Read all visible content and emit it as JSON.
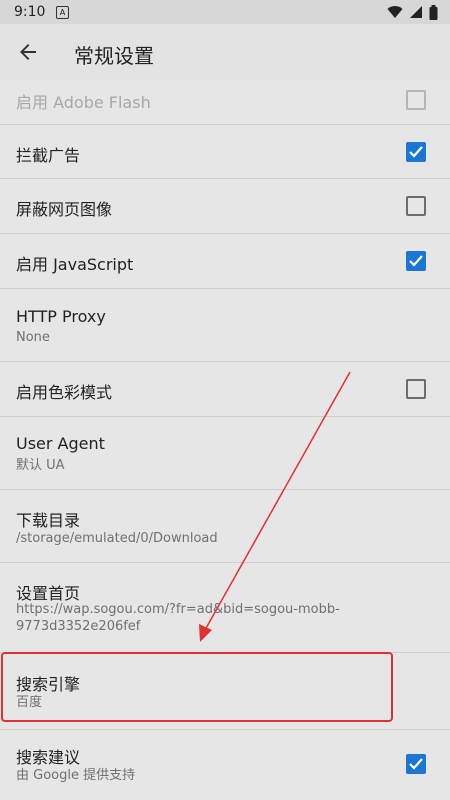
{
  "status_bar": {
    "time": "9:10",
    "notification_icon": "A"
  },
  "app_bar": {
    "back_icon": "arrow-left-icon",
    "title": "常规设置"
  },
  "settings": [
    {
      "title": "启用 Adobe Flash",
      "checkbox": true,
      "checked": false,
      "disabled": true
    },
    {
      "title": "拦截广告",
      "checkbox": true,
      "checked": true
    },
    {
      "title": "屏蔽网页图像",
      "checkbox": true,
      "checked": false
    },
    {
      "title": "启用 JavaScript",
      "checkbox": true,
      "checked": true
    },
    {
      "title": "HTTP Proxy",
      "subtitle": "None"
    },
    {
      "title": "启用色彩模式",
      "checkbox": true,
      "checked": false
    },
    {
      "title": "User Agent",
      "subtitle": "默认 UA"
    },
    {
      "title": "下载目录",
      "subtitle": "/storage/emulated/0/Download"
    },
    {
      "title": "设置首页",
      "subtitle": "https://wap.sogou.com/?fr=ad&bid=sogou-mobb-9773d3352e206fef"
    },
    {
      "title": "搜索引擎",
      "subtitle": "百度",
      "highlighted": true
    },
    {
      "title": "搜索建议",
      "subtitle": "由 Google 提供支持",
      "checkbox": true,
      "checked": true
    }
  ],
  "colors": {
    "accent": "#1976d2",
    "highlight": "#e23131",
    "background": "#e6e6e6"
  }
}
